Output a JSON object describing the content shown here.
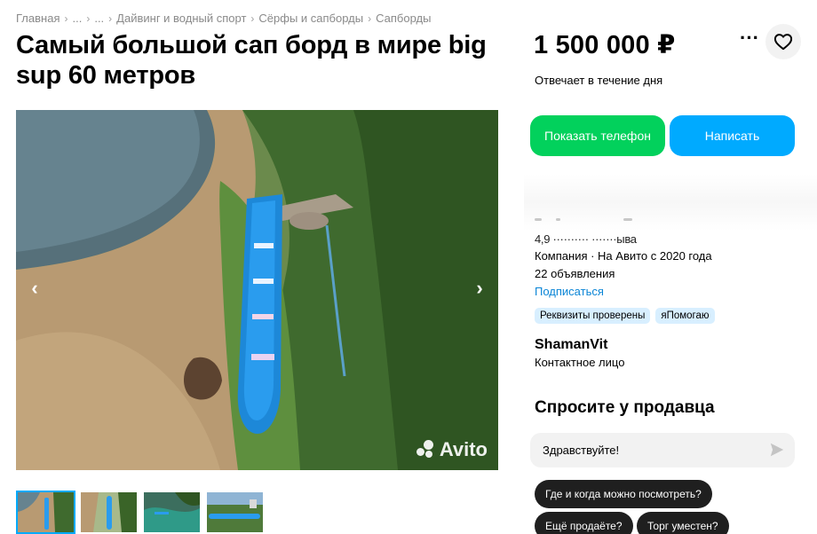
{
  "breadcrumb": {
    "items": [
      "Главная",
      "...",
      "...",
      "Дайвинг и водный спорт",
      "Сёрфы и сапборды",
      "Сапборды"
    ],
    "separator": "›"
  },
  "listing": {
    "title": "Самый большой сап борд в мире big sup 60 метров",
    "price": "1 500 000 ₽",
    "reply_note": "Отвечает в течение дня",
    "gallery": {
      "prev_icon": "‹",
      "next_icon": "›",
      "watermark": "Avito",
      "thumbnail_count": 4,
      "active_index": 0
    }
  },
  "actions": {
    "more_icon": "···",
    "phone_button": "Показать телефон",
    "write_button": "Написать"
  },
  "seller": {
    "rating_text": "4,9 ·········· ·······ыва",
    "type_text": "Компания · На Авито с 2020 года",
    "ads_count": "22 объявления",
    "subscribe_label": "Подписаться",
    "badges": [
      "Реквизиты проверены",
      "яПомогаю"
    ],
    "contact_name": "ShamanVit",
    "contact_role": "Контактное лицо"
  },
  "ask": {
    "title": "Спросите у продавца",
    "input_value": "Здравствуйте!",
    "quick_questions": [
      "Где и когда можно посмотреть?",
      "Ещё продаёте?",
      "Торг уместен?"
    ]
  },
  "colors": {
    "green_button": "#02d15c",
    "blue_button": "#00aaff",
    "link": "#0a85d6",
    "badge_bg": "#d8efff",
    "chip_bg": "#1f1f1f"
  }
}
